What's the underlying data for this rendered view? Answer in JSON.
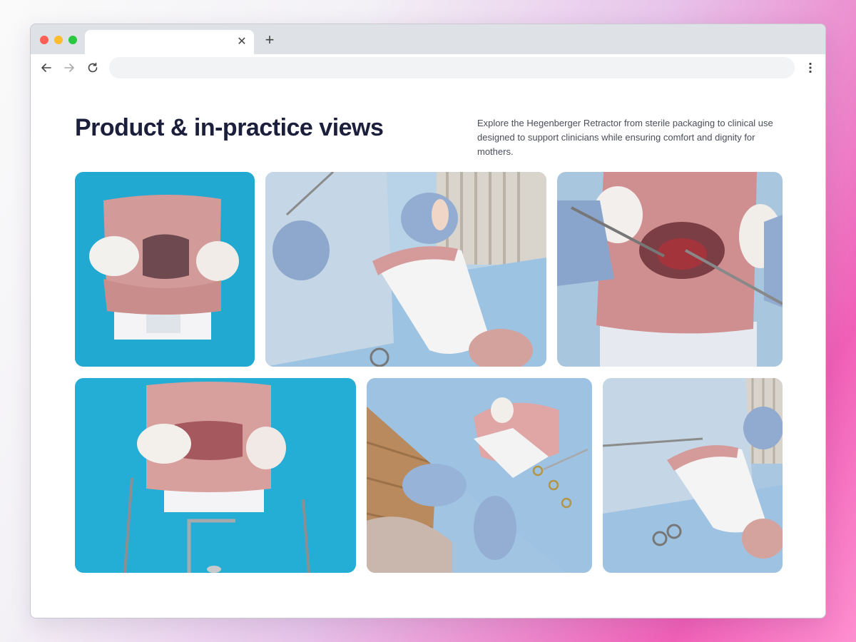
{
  "browser": {
    "address_value": "",
    "tab_title": "",
    "icons": {
      "back": "arrow-left-icon",
      "forward": "arrow-right-icon",
      "reload": "reload-icon",
      "menu": "kebab-menu-icon",
      "close_tab": "close-icon",
      "new_tab": "plus-icon"
    }
  },
  "section": {
    "title": "Product & in-practice views",
    "description_line1": "Explore the Hegenberger Retractor from sterile packaging to clinical use",
    "description_line2": "designed to support clinicians while ensuring comfort and dignity for mothers."
  },
  "colors": {
    "title": "#1c1f3b",
    "drape_teal": "#27b3d8",
    "drape_blue": "#9cc5e2",
    "knit_pink": "#d69a9a",
    "glove_blue": "#9fb8dc"
  }
}
